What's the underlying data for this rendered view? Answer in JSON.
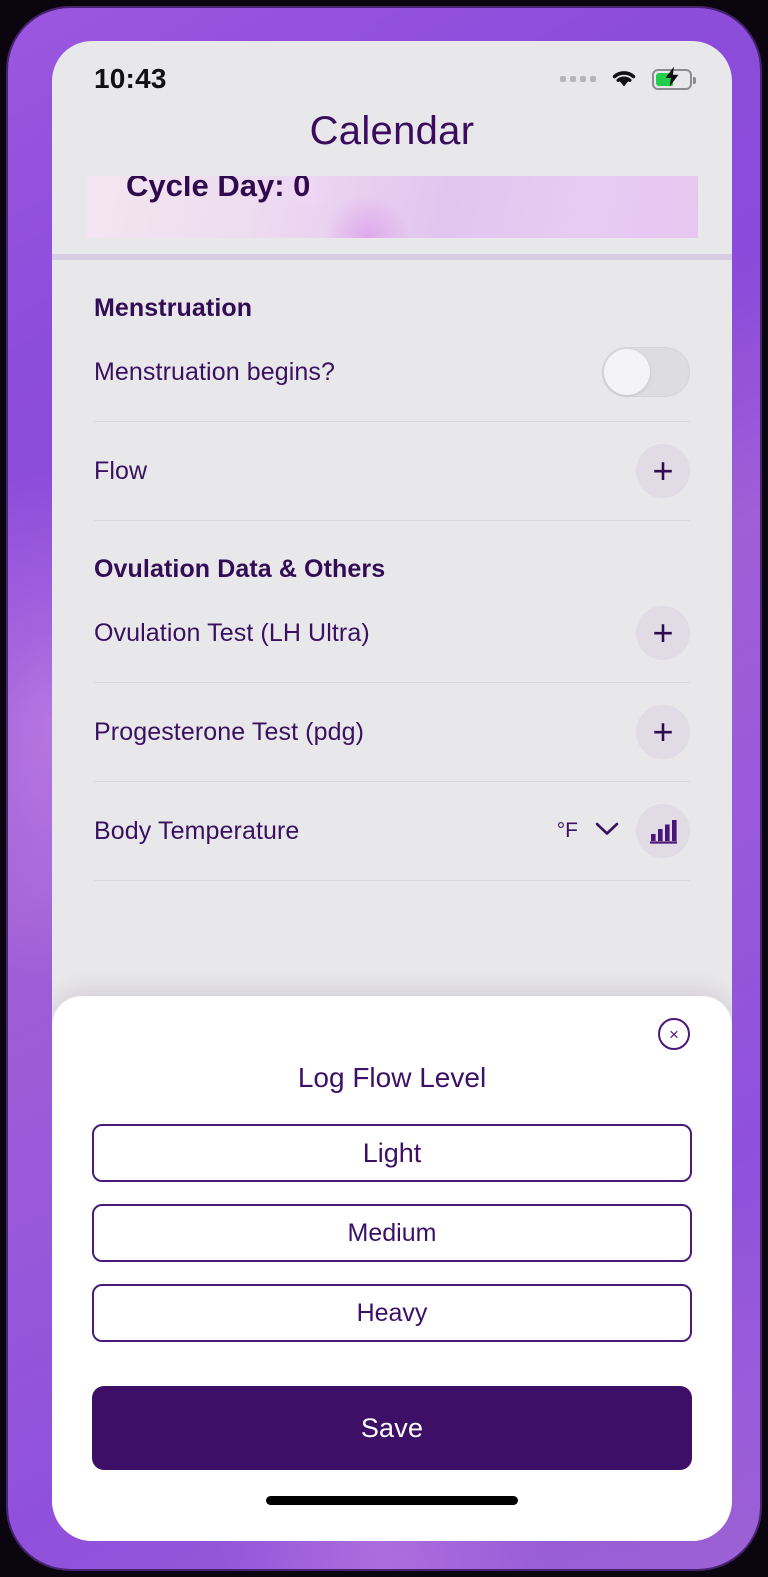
{
  "status_bar": {
    "time": "10:43",
    "signal_icon": "signal-dots-icon",
    "wifi_icon": "wifi-icon",
    "battery_icon": "battery-charging-icon",
    "battery_level_percent": 46
  },
  "header": {
    "title": "Calendar"
  },
  "hero_card": {
    "label": "Cycle Day: 0"
  },
  "sections": [
    {
      "title": "Menstruation",
      "rows": [
        {
          "label": "Menstruation begins?",
          "control": "toggle",
          "toggle_on": false
        },
        {
          "label": "Flow",
          "control": "plus",
          "plus_label": "+"
        }
      ]
    },
    {
      "title": "Ovulation Data & Others",
      "rows": [
        {
          "label": "Ovulation Test (LH Ultra)",
          "control": "plus",
          "plus_label": "+"
        },
        {
          "label": "Progesterone Test (pdg)",
          "control": "plus",
          "plus_label": "+"
        },
        {
          "label": "Body Temperature",
          "control": "unit-chart",
          "unit": "°F",
          "chevron_icon": "chevron-down-icon",
          "chart_icon": "bar-chart-icon"
        }
      ]
    }
  ],
  "modal": {
    "close_icon": "close-circle-icon",
    "close_glyph": "×",
    "title": "Log Flow Level",
    "options": [
      {
        "label": "Light"
      },
      {
        "label": "Medium"
      },
      {
        "label": "Heavy"
      }
    ],
    "save_label": "Save"
  },
  "colors": {
    "accent_purple": "#3d0f66",
    "frame_purple": "#8f50dc",
    "screen_bg": "#e8e7e9",
    "battery_green": "#23cc4a",
    "divider": "#d6cde4"
  }
}
